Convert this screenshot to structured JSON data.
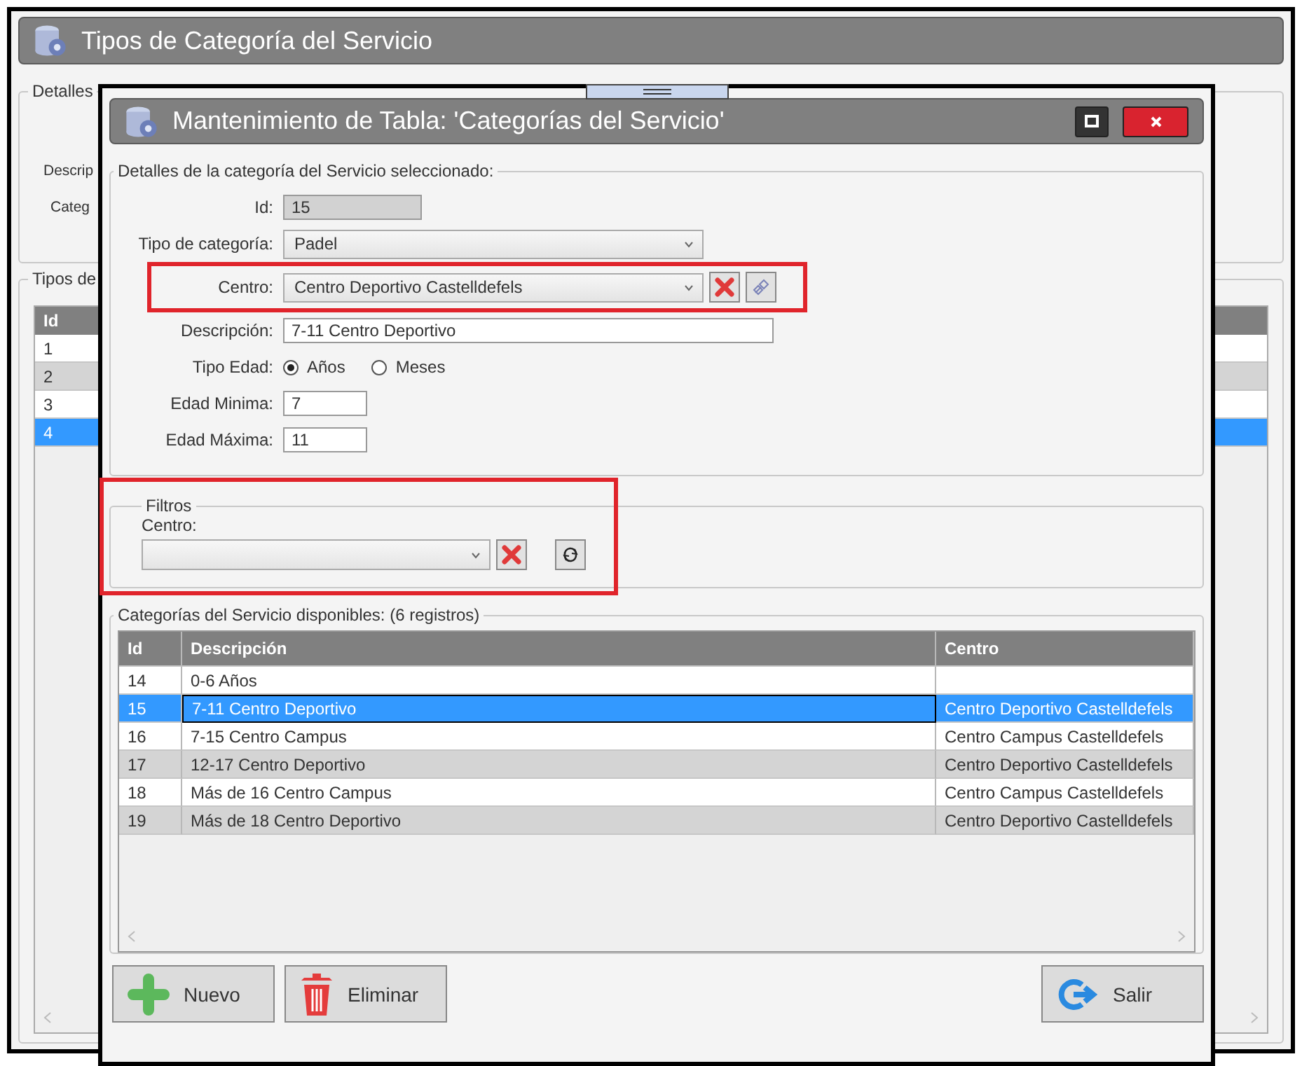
{
  "background_window": {
    "title": "Tipos de Categoría del Servicio",
    "details_group": {
      "legend": "Detalles",
      "labels": [
        "Descrip",
        "Categ"
      ]
    },
    "list_group": {
      "legend": "Tipos de",
      "columns": [
        "Id"
      ],
      "rows": [
        {
          "id": "1",
          "selected": false
        },
        {
          "id": "2",
          "selected": false
        },
        {
          "id": "3",
          "selected": false
        },
        {
          "id": "4",
          "selected": true
        }
      ]
    }
  },
  "dialog": {
    "title": "Mantenimiento de Tabla: 'Categorías del Servicio'",
    "details": {
      "legend": "Detalles de la categoría del Servicio seleccionado:",
      "id": {
        "label": "Id:",
        "value": "15"
      },
      "tipo_categoria": {
        "label": "Tipo de categoría:",
        "value": "Padel"
      },
      "centro": {
        "label": "Centro:",
        "value": "Centro Deportivo Castelldefels",
        "highlighted": true
      },
      "descripcion": {
        "label": "Descripción:",
        "value": "7-11 Centro Deportivo"
      },
      "tipo_edad": {
        "label": "Tipo Edad:",
        "options": [
          {
            "label": "Años",
            "selected": true
          },
          {
            "label": "Meses",
            "selected": false
          }
        ]
      },
      "edad_minima": {
        "label": "Edad Minima:",
        "value": "7"
      },
      "edad_maxima": {
        "label": "Edad Máxima:",
        "value": "11"
      }
    },
    "filters": {
      "legend": "Filtros",
      "highlighted": true,
      "centro_label": "Centro:"
    },
    "list": {
      "legend": "Categorías del Servicio disponibles:",
      "count": "(6 registros)",
      "columns": [
        "Id",
        "Descripción",
        "Centro"
      ],
      "rows": [
        {
          "id": "14",
          "descripcion": "0-6 Años",
          "centro": "",
          "selected": false
        },
        {
          "id": "15",
          "descripcion": "7-11 Centro Deportivo",
          "centro": "Centro Deportivo Castelldefels",
          "selected": true
        },
        {
          "id": "16",
          "descripcion": "7-15 Centro Campus",
          "centro": "Centro Campus Castelldefels",
          "selected": false
        },
        {
          "id": "17",
          "descripcion": "12-17 Centro Deportivo",
          "centro": "Centro Deportivo Castelldefels",
          "selected": false
        },
        {
          "id": "18",
          "descripcion": "Más de 16 Centro Campus",
          "centro": "Centro Campus Castelldefels",
          "selected": false
        },
        {
          "id": "19",
          "descripcion": "Más de 18 Centro Deportivo",
          "centro": "Centro Deportivo Castelldefels",
          "selected": false
        }
      ]
    },
    "buttons": [
      {
        "label": "Nuevo",
        "kind": "add"
      },
      {
        "label": "Eliminar",
        "kind": "delete"
      },
      {
        "label": "Salir",
        "kind": "exit"
      }
    ]
  }
}
